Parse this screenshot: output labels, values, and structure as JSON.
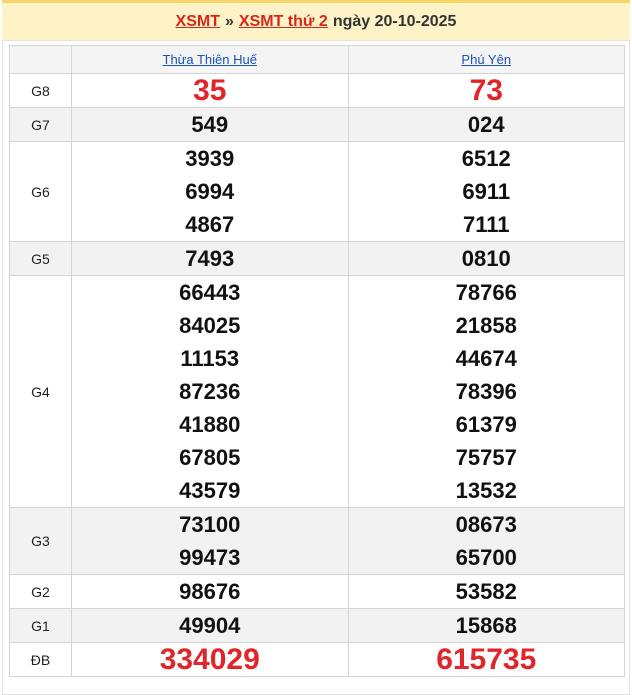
{
  "header": {
    "link_region": "XSMT",
    "separator": "»",
    "link_day": "XSMT thứ 2",
    "date_text": "ngày 20-10-2025"
  },
  "columns": [
    "Thừa Thiên Huế",
    "Phú Yên"
  ],
  "accent_color": "#e0252b",
  "prizes": [
    {
      "label": "G8",
      "big": true,
      "values": [
        [
          "35"
        ],
        [
          "73"
        ]
      ]
    },
    {
      "label": "G7",
      "big": false,
      "values": [
        [
          "549"
        ],
        [
          "024"
        ]
      ]
    },
    {
      "label": "G6",
      "big": false,
      "values": [
        [
          "3939",
          "6994",
          "4867"
        ],
        [
          "6512",
          "6911",
          "7111"
        ]
      ]
    },
    {
      "label": "G5",
      "big": false,
      "values": [
        [
          "7493"
        ],
        [
          "0810"
        ]
      ]
    },
    {
      "label": "G4",
      "big": false,
      "values": [
        [
          "66443",
          "84025",
          "11153",
          "87236",
          "41880",
          "67805",
          "43579"
        ],
        [
          "78766",
          "21858",
          "44674",
          "78396",
          "61379",
          "75757",
          "13532"
        ]
      ]
    },
    {
      "label": "G3",
      "big": false,
      "values": [
        [
          "73100",
          "99473"
        ],
        [
          "08673",
          "65700"
        ]
      ]
    },
    {
      "label": "G2",
      "big": false,
      "values": [
        [
          "98676"
        ],
        [
          "53582"
        ]
      ]
    },
    {
      "label": "G1",
      "big": false,
      "values": [
        [
          "49904"
        ],
        [
          "15868"
        ]
      ]
    },
    {
      "label": "ĐB",
      "big": true,
      "values": [
        [
          "334029"
        ],
        [
          "615735"
        ]
      ]
    }
  ]
}
